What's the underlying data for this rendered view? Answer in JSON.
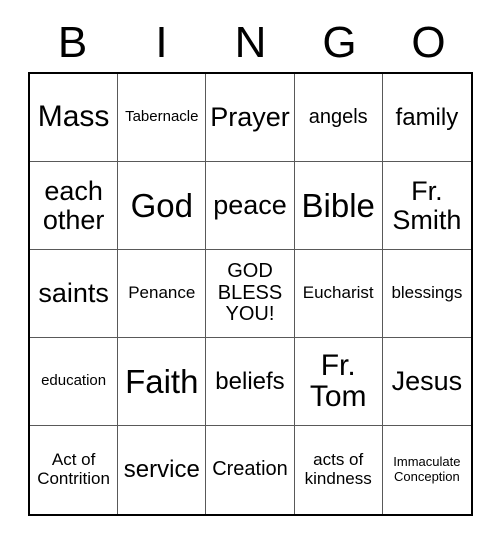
{
  "card": {
    "title": "BINGO Card",
    "header_letters": [
      "B",
      "I",
      "N",
      "G",
      "O"
    ],
    "colors": {
      "text": "#000000",
      "background": "#ffffff",
      "outer_border": "#000000",
      "inner_border": "#595959"
    },
    "grid": {
      "rows": 5,
      "columns": 5,
      "free_space": {
        "row": 3,
        "column": 3,
        "text": "GOD\nBLESS\nYOU!"
      },
      "cells": [
        [
          {
            "text": "Mass",
            "size": "fs-3xl"
          },
          {
            "text": "Tabernacle",
            "size": "fs-sm"
          },
          {
            "text": "Prayer",
            "size": "fs-2xl"
          },
          {
            "text": "angels",
            "size": "fs-lg"
          },
          {
            "text": "family",
            "size": "fs-xl"
          }
        ],
        [
          {
            "text": "each\nother",
            "size": "fs-2xl"
          },
          {
            "text": "God",
            "size": "fs-4xl"
          },
          {
            "text": "peace",
            "size": "fs-2xl"
          },
          {
            "text": "Bible",
            "size": "fs-4xl"
          },
          {
            "text": "Fr.\nSmith",
            "size": "fs-2xl"
          }
        ],
        [
          {
            "text": "saints",
            "size": "fs-2xl"
          },
          {
            "text": "Penance",
            "size": "fs-md"
          },
          {
            "text": "GOD\nBLESS\nYOU!",
            "size": "fs-lg"
          },
          {
            "text": "Eucharist",
            "size": "fs-md"
          },
          {
            "text": "blessings",
            "size": "fs-md"
          }
        ],
        [
          {
            "text": "education",
            "size": "fs-sm"
          },
          {
            "text": "Faith",
            "size": "fs-4xl"
          },
          {
            "text": "beliefs",
            "size": "fs-xl"
          },
          {
            "text": "Fr.\nTom",
            "size": "fs-3xl"
          },
          {
            "text": "Jesus",
            "size": "fs-2xl"
          }
        ],
        [
          {
            "text": "Act of\nContrition",
            "size": "fs-md"
          },
          {
            "text": "service",
            "size": "fs-xl"
          },
          {
            "text": "Creation",
            "size": "fs-lg"
          },
          {
            "text": "acts of\nkindness",
            "size": "fs-md"
          },
          {
            "text": "Immaculate\nConception",
            "size": "fs-xs"
          }
        ]
      ]
    }
  }
}
